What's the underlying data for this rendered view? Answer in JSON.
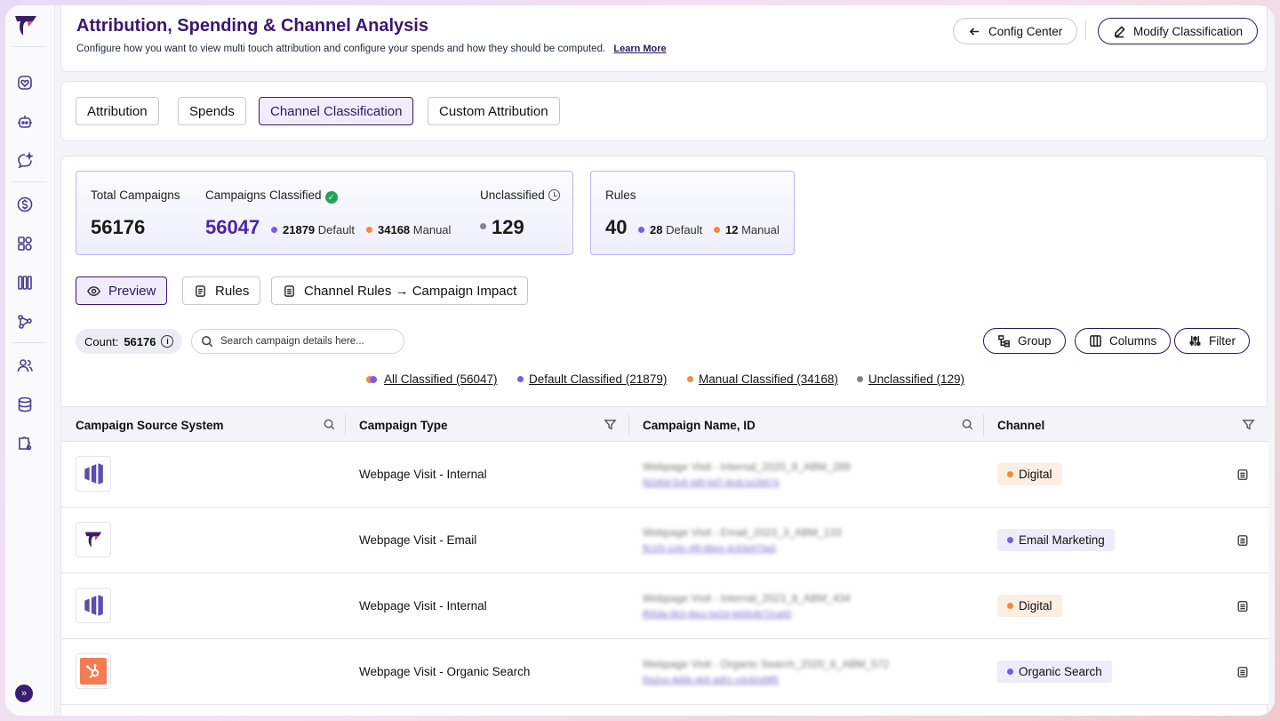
{
  "header": {
    "title": "Attribution, Spending & Channel Analysis",
    "subtitle": "Configure how you want to view multi touch attribution and configure your spends and how they should be computed.",
    "learn_more": "Learn More",
    "config_center": "Config Center",
    "modify_classification": "Modify Classification"
  },
  "tabs": [
    "Attribution",
    "Spends",
    "Channel Classification",
    "Custom Attribution"
  ],
  "active_tab": "Channel Classification",
  "stats": {
    "total_label": "Total Campaigns",
    "total_value": "56176",
    "classified_label": "Campaigns Classified",
    "classified_value": "56047",
    "classified_default_num": "21879",
    "classified_default_text": "Default",
    "classified_manual_num": "34168",
    "classified_manual_text": "Manual",
    "unclassified_label": "Unclassified",
    "unclassified_value": "129",
    "rules_label": "Rules",
    "rules_value": "40",
    "rules_default_num": "28",
    "rules_default_text": "Default",
    "rules_manual_num": "12",
    "rules_manual_text": "Manual"
  },
  "views": {
    "preview": "Preview",
    "rules": "Rules",
    "impact": "Channel Rules → Campaign Impact"
  },
  "toolbar": {
    "count_label": "Count:",
    "count_value": "56176",
    "search_placeholder": "Search campaign details here...",
    "group": "Group",
    "columns": "Columns",
    "filter": "Filter"
  },
  "legend": {
    "all": "All Classified (56047)",
    "default": "Default Classified (21879)",
    "manual": "Manual Classified (34168)",
    "unclassified": "Unclassified (129)"
  },
  "table": {
    "headers": [
      "Campaign Source System",
      "Campaign Type",
      "Campaign Name, ID",
      "Channel"
    ],
    "rows": [
      {
        "source_icon": "marketo-icon",
        "type": "Webpage Visit - Internal",
        "name": "Webpage Visit - Internal_2020_8_ABM_289",
        "id": "f92d6d-5c8-4d0-bd7-9cdc1e2b674",
        "channel": "Digital",
        "channel_color": "#f08a3e"
      },
      {
        "source_icon": "brand-icon",
        "type": "Webpage Visit - Email",
        "name": "Webpage Visit - Email_2023_3_ABM_133",
        "id": "ffc1f3-1c6c-4f0-8bee-4c93e675a5",
        "channel": "Email Marketing",
        "channel_color": "#7b5ce6"
      },
      {
        "source_icon": "marketo-icon",
        "type": "Webpage Visit - Internal",
        "name": "Webpage Visit - Internal_2023_8_ABM_434",
        "id": "ff05da-5b3-4bcc-bd1b-b6554b72ca65",
        "channel": "Digital",
        "channel_color": "#f08a3e"
      },
      {
        "source_icon": "hubspot-icon",
        "type": "Webpage Visit - Organic Search",
        "name": "Webpage Visit - Organic Search_2020_6_ABM_572",
        "id": "f0a2ce-8d0b-4b5-ad61-c0c82d9ff5",
        "channel": "Organic Search",
        "channel_color": "#7b5ce6"
      }
    ]
  }
}
